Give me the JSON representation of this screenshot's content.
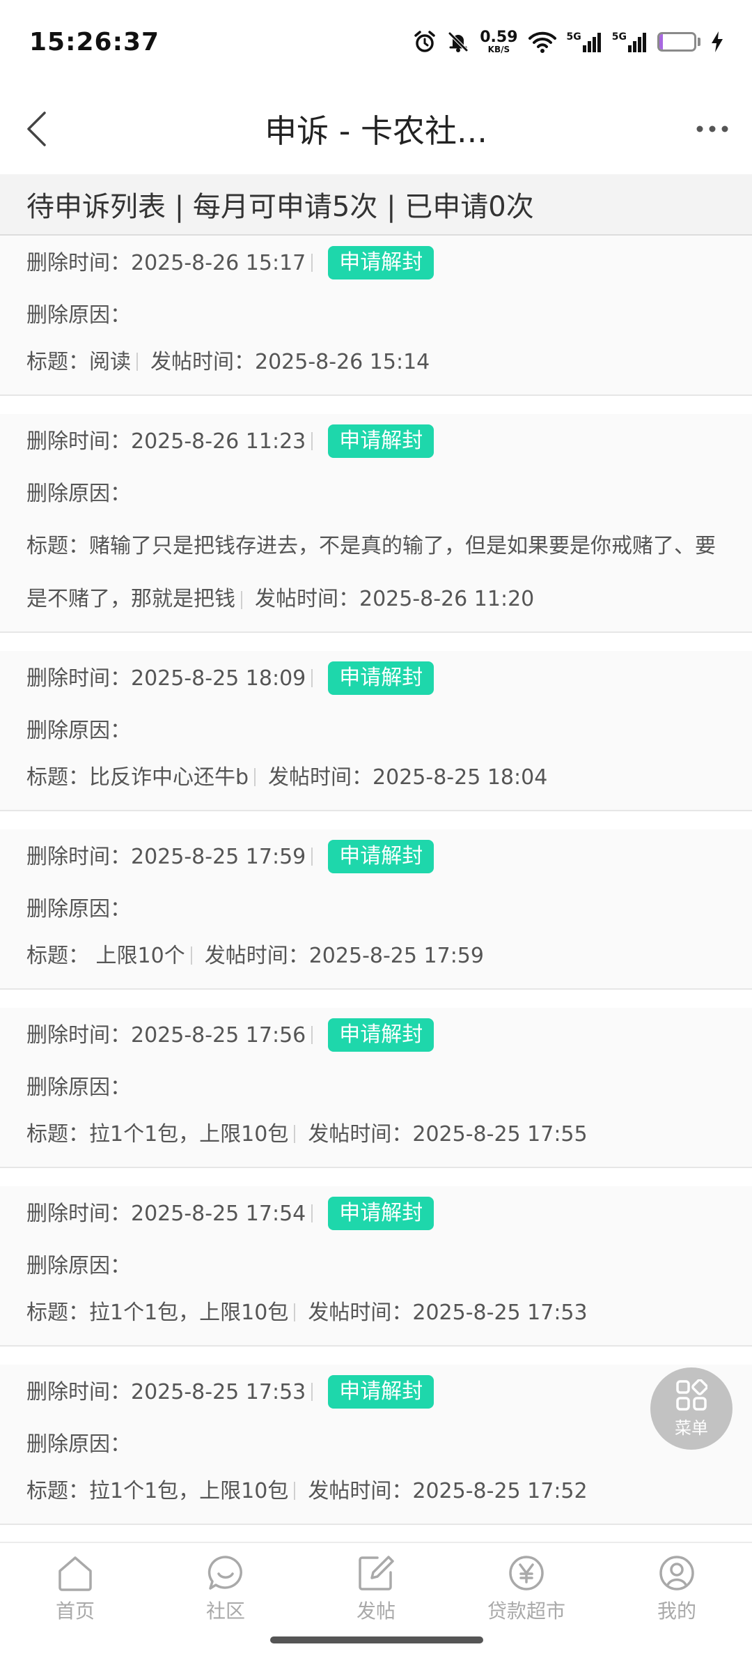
{
  "status": {
    "time": "15:26:37",
    "net_speed_value": "0.59",
    "net_speed_unit": "KB/S",
    "signal1_label": "5G",
    "signal2_label": "5G",
    "battery_level": "11",
    "battery_fraction": 0.11
  },
  "nav": {
    "title": "申诉 - 卡农社..."
  },
  "list_header": {
    "text": "待申诉列表 | 每月可申请5次 | 已申请0次"
  },
  "labels": {
    "delete_time": "删除时间：",
    "delete_reason": "删除原因：",
    "title": "标题：",
    "post_time": "发帖时间：",
    "appeal_button": "申请解封"
  },
  "records": [
    {
      "delete_time": "2025-8-26 15:17",
      "reason": "",
      "title": "阅读",
      "post_time": "2025-8-26 15:14"
    },
    {
      "delete_time": "2025-8-26 11:23",
      "reason": "",
      "title": "赌输了只是把钱存进去，不是真的输了，但是如果要是你戒赌了、要是不赌了，那就是把钱",
      "post_time": "2025-8-26 11:20"
    },
    {
      "delete_time": "2025-8-25 18:09",
      "reason": "",
      "title": "比反诈中心还牛b",
      "post_time": "2025-8-25 18:04"
    },
    {
      "delete_time": "2025-8-25 17:59",
      "reason": "",
      "title": " 上限10个",
      "post_time": "2025-8-25 17:59"
    },
    {
      "delete_time": "2025-8-25 17:56",
      "reason": "",
      "title": "拉1个1包，上限10包",
      "post_time": "2025-8-25 17:55"
    },
    {
      "delete_time": "2025-8-25 17:54",
      "reason": "",
      "title": "拉1个1包，上限10包",
      "post_time": "2025-8-25 17:53"
    },
    {
      "delete_time": "2025-8-25 17:53",
      "reason": "",
      "title": "拉1个1包，上限10包",
      "post_time": "2025-8-25 17:52"
    }
  ],
  "fab": {
    "label": "菜单"
  },
  "tabs": [
    {
      "label": "首页",
      "icon": "home-icon"
    },
    {
      "label": "社区",
      "icon": "chat-icon"
    },
    {
      "label": "发帖",
      "icon": "edit-icon"
    },
    {
      "label": "贷款超市",
      "icon": "yen-icon"
    },
    {
      "label": "我的",
      "icon": "profile-icon"
    }
  ],
  "colors": {
    "accent": "#1ed7ab",
    "tab_inactive": "#a9a9a9",
    "battery_fill": "#a868e0"
  }
}
